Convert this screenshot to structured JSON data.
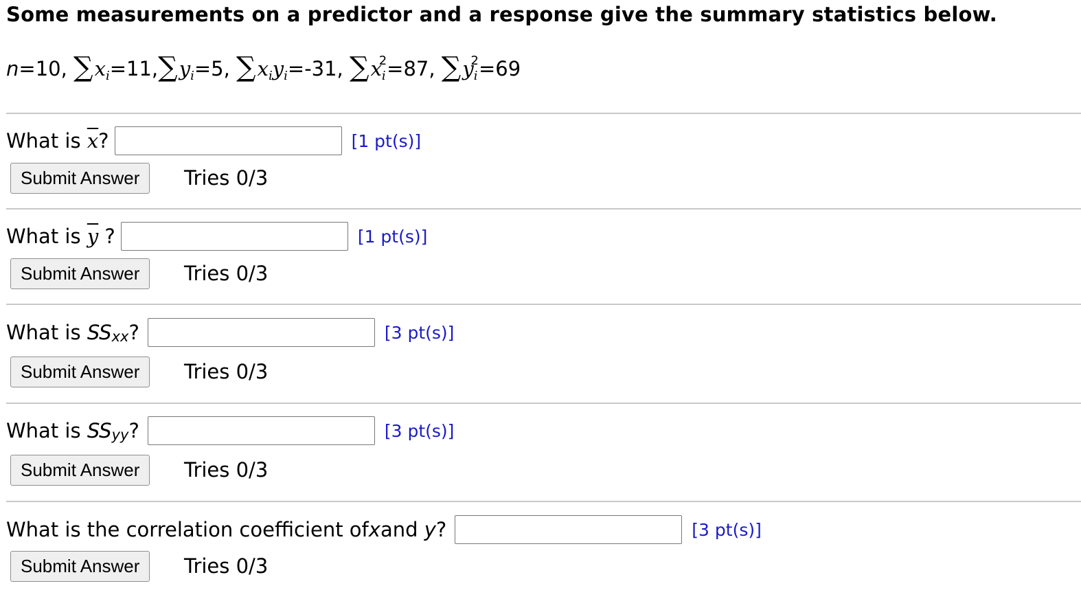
{
  "header": {
    "title": "Some measurements on a predictor and a response give the summary statistics below."
  },
  "stats": {
    "n_label": "n",
    "n_value": "=10,",
    "sum_x": "=11,",
    "sum_y": "=5,",
    "sum_xy": "=-31,",
    "sum_x2": "=87,",
    "sum_y2": "=69",
    "var_x": "x",
    "var_y": "y",
    "index": "i",
    "power": "2",
    "sigma": "∑"
  },
  "questions": [
    {
      "prefix": "What is ",
      "symbol": "x",
      "suffix": "?",
      "points": "[1 pt(s)]",
      "submit_label": "Submit Answer",
      "tries": "Tries 0/3",
      "answer_value": ""
    },
    {
      "prefix": "What is ",
      "symbol": "y",
      "suffix": "?",
      "points": "[1 pt(s)]",
      "submit_label": "Submit Answer",
      "tries": "Tries 0/3",
      "answer_value": ""
    },
    {
      "prefix": "What is ",
      "symbol": "SS",
      "subscript": "xx",
      "suffix": "?",
      "points": "[3 pt(s)]",
      "submit_label": "Submit Answer",
      "tries": "Tries 0/3",
      "answer_value": ""
    },
    {
      "prefix": "What is ",
      "symbol": "SS",
      "subscript": "yy",
      "suffix": "?",
      "points": "[3 pt(s)]",
      "submit_label": "Submit Answer",
      "tries": "Tries 0/3",
      "answer_value": ""
    },
    {
      "text1": "What is the correlation coefficient of ",
      "var1": "x",
      "text2": " and ",
      "var2": "y",
      "suffix": "?",
      "points": "[3 pt(s)]",
      "submit_label": "Submit Answer",
      "tries": "Tries 0/3",
      "answer_value": ""
    }
  ],
  "colors": {
    "points_link": "#1a1ac8",
    "divider": "#c8c8c8",
    "button_bg": "#efefef"
  }
}
